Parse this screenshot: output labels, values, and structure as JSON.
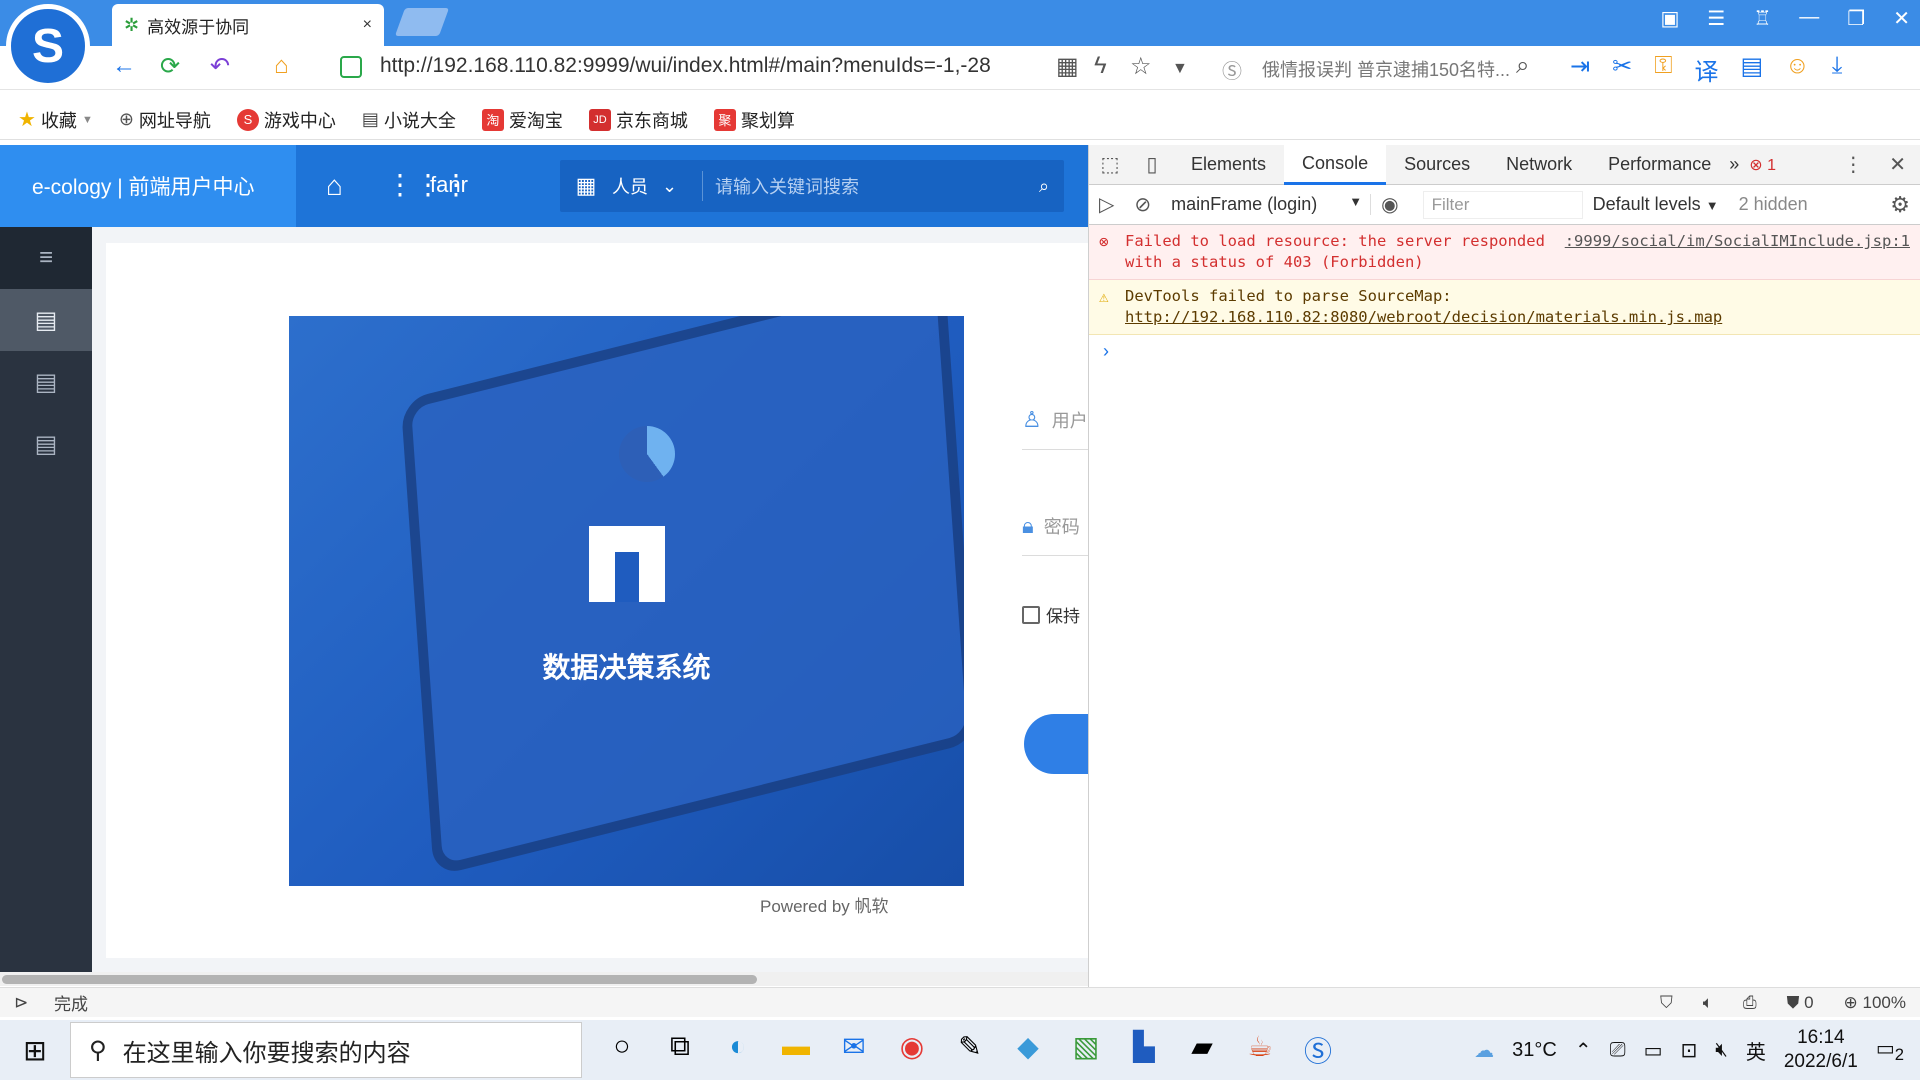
{
  "browser": {
    "tab_title": "高效源于协同",
    "tab_close": "×",
    "url": "http://192.168.110.82:9999/wui/index.html#/main?menuIds=-1,-28",
    "search_placeholder": "俄情报误判 普京逮捕150名特..."
  },
  "bookmarks": [
    {
      "label": "收藏",
      "icon": "star-icon"
    },
    {
      "label": "网址导航",
      "icon": "globe-icon"
    },
    {
      "label": "游戏中心",
      "icon": "game-icon"
    },
    {
      "label": "小说大全",
      "icon": "book-icon"
    },
    {
      "label": "爱淘宝",
      "icon": "taobao-icon"
    },
    {
      "label": "京东商城",
      "icon": "jd-icon"
    },
    {
      "label": "聚划算",
      "icon": "juhuasuan-icon"
    }
  ],
  "app": {
    "brand": "e-cology | 前端用户中心",
    "user": "fanr",
    "search_scope": "人员",
    "search_placeholder": "请输入关键词搜索",
    "hero_title": "数据决策系统",
    "username_placeholder": "用户",
    "password_placeholder": "密码",
    "remember_label": "保持",
    "powered_by": "Powered by 帆软"
  },
  "devtools": {
    "tabs": [
      "Elements",
      "Console",
      "Sources",
      "Network",
      "Performance"
    ],
    "active_tab": "Console",
    "more": "»",
    "error_count": "1",
    "context": "mainFrame (login)",
    "filter_placeholder": "Filter",
    "levels": "Default levels",
    "hidden": "2 hidden",
    "messages": [
      {
        "type": "error",
        "text": "Failed to load resource: the server responded with a status of 403 (Forbidden)",
        "source": ":9999/social/im/SocialIMInclude.jsp:1"
      },
      {
        "type": "warn",
        "text": "DevTools failed to parse SourceMap: ",
        "link": "http://192.168.110.82:8080/webroot/decision/materials.min.js.map"
      }
    ],
    "prompt": "›"
  },
  "status": {
    "text": "完成",
    "zoom": "100%",
    "blocked": "0"
  },
  "taskbar": {
    "search_placeholder": "在这里输入你要搜索的内容",
    "weather": "31°C",
    "ime": "英",
    "time": "16:14",
    "date": "2022/6/1",
    "notifications": "2"
  }
}
